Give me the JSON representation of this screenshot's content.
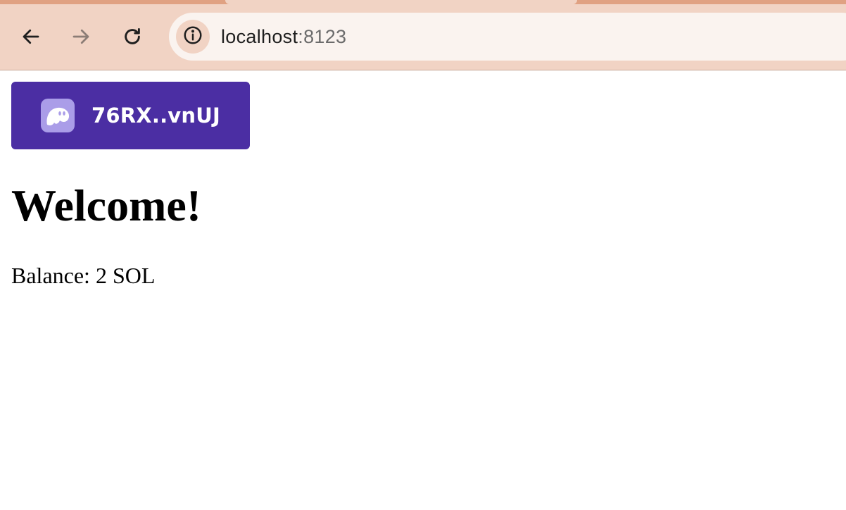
{
  "browser": {
    "url_host": "localhost",
    "url_port": ":8123",
    "back_icon": "arrow-left-icon",
    "forward_icon": "arrow-right-icon",
    "reload_icon": "reload-icon",
    "site_info_icon": "info-circle-icon",
    "chrome_color": "#f1d3c4",
    "omnibox_color": "#faf3ef"
  },
  "wallet": {
    "address": "76RX..vnUJ",
    "logo_icon": "phantom-ghost-icon",
    "button_color": "#4b2ea3",
    "logo_bg_color": "#aa9de8"
  },
  "page": {
    "title": "Welcome!",
    "balance_text": "Balance: 2 SOL"
  }
}
